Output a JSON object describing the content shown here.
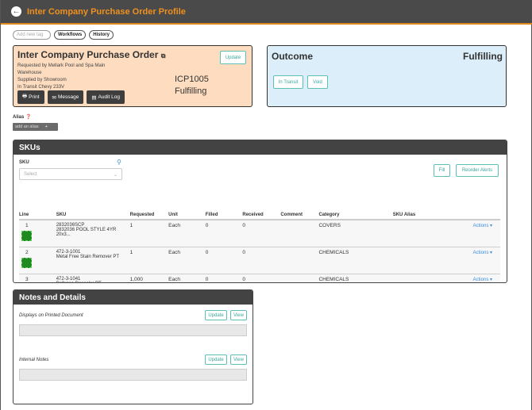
{
  "header": {
    "title": "Inter Company Purchase Order Profile"
  },
  "tags": {
    "placeholder": "Add new tag",
    "workflows": "Workflows",
    "history": "History"
  },
  "order": {
    "title": "Inter Company Purchase Order",
    "requested_by": "Requested by Mellark Pool and Spa Main",
    "requested_by2": "Warehouse",
    "supplied_by": "Supplied by Showroom",
    "transit": "In Transit Chevy 233V",
    "number": "ICP1005",
    "status": "Fulfilling",
    "update": "Update",
    "print": "Print",
    "message": "Message",
    "audit_log": "Audit Log"
  },
  "outcome": {
    "title": "Outcome",
    "status": "Fulfilling",
    "in_transit": "In Transit",
    "void": "Void"
  },
  "alias": {
    "label": "Alias",
    "add": "add an alias"
  },
  "skus": {
    "title": "SKUs",
    "sku_label": "SKU",
    "select_placeholder": "Select",
    "fill": "Fill",
    "reorder": "Reorder Alerts",
    "columns": [
      "Line",
      "SKU",
      "Requested",
      "Unit",
      "Filled",
      "Received",
      "Comment",
      "Category",
      "SKU Alias",
      ""
    ],
    "rows": [
      {
        "line": "1",
        "sku": "2832036SCP",
        "desc": "2832036 POOL STYLE 4YR 20x3...",
        "requested": "1",
        "unit": "Each",
        "filled": "0",
        "received": "0",
        "comment": "",
        "category": "COVERS",
        "alias": "",
        "action": "Actions ▾"
      },
      {
        "line": "2",
        "sku": "472-3-1001",
        "desc": "Metal Free Stain Remover PT",
        "requested": "1",
        "unit": "Each",
        "filled": "0",
        "received": "0",
        "comment": "",
        "category": "CHEMICALS",
        "alias": "",
        "action": "Actions ▾"
      },
      {
        "line": "3",
        "sku": "472-3-1041",
        "desc": "Defense Descaler PT",
        "requested": "1,000",
        "unit": "Each",
        "filled": "0",
        "received": "0",
        "comment": "",
        "category": "CHEMICALS",
        "alias": "",
        "action": "Actions ▾"
      }
    ]
  },
  "notes": {
    "title": "Notes and Details",
    "printed": "Displays on Printed Document",
    "internal": "Internal Notes",
    "update": "Update",
    "view": "View"
  }
}
